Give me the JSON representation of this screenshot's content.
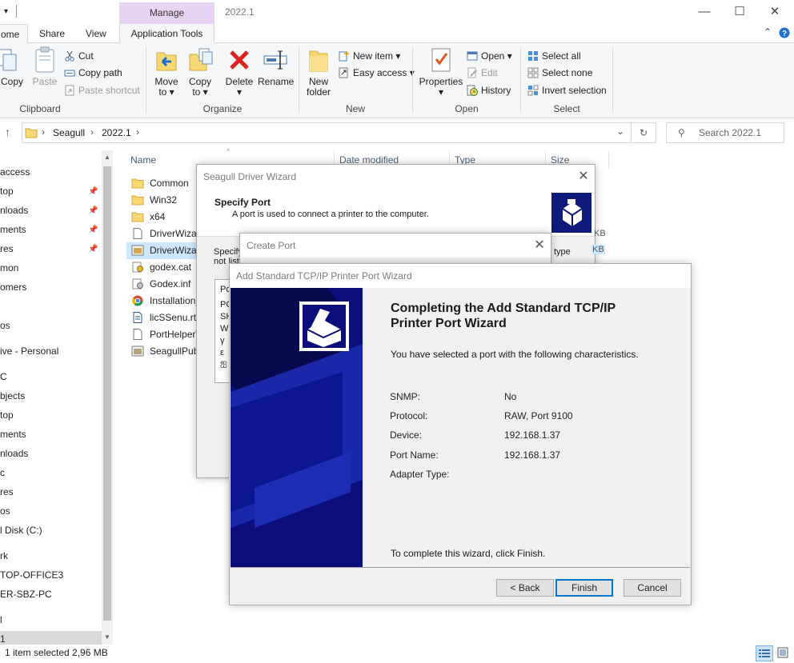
{
  "window": {
    "title": "2022.1",
    "manage_tab": "Manage",
    "minimize": "—",
    "maximize": "☐",
    "close": "✕"
  },
  "tabs": [
    "ome",
    "Share",
    "View",
    "Application Tools"
  ],
  "ribbon": {
    "clipboard": {
      "label": "Clipboard",
      "copy": "Copy",
      "paste": "Paste",
      "cut": "Cut",
      "copy_path": "Copy path",
      "paste_shortcut": "Paste shortcut"
    },
    "organize": {
      "label": "Organize",
      "move_to": "Move",
      "move_to_2": "to",
      "copy_to": "Copy",
      "copy_to_2": "to",
      "delete": "Delete",
      "rename": "Rename"
    },
    "new": {
      "label": "New",
      "new_folder": "New",
      "new_folder_2": "folder",
      "new_item": "New item",
      "easy_access": "Easy access"
    },
    "open": {
      "label": "Open",
      "properties": "Properties",
      "open": "Open",
      "edit": "Edit",
      "history": "History"
    },
    "select": {
      "label": "Select",
      "select_all": "Select all",
      "select_none": "Select none",
      "invert": "Invert selection"
    }
  },
  "address": {
    "crumbs": [
      "Seagull",
      "2022.1"
    ],
    "search_placeholder": "Search 2022.1"
  },
  "nav": {
    "items": [
      "access",
      "top",
      "nloads",
      "ments",
      "res",
      "mon",
      "omers",
      "",
      "os",
      "ive - Personal",
      "C",
      "bjects",
      "top",
      "ments",
      "nloads",
      "c",
      "res",
      "os",
      "l Disk (C:)",
      "",
      "rk",
      "TOP-OFFICE3",
      "ER-SBZ-PC",
      "",
      "l",
      "1"
    ]
  },
  "columns": {
    "name": "Name",
    "date": "Date modified",
    "type": "Type",
    "size": "Size"
  },
  "files": [
    {
      "name": "Common",
      "kind": "folder"
    },
    {
      "name": "Win32",
      "kind": "folder"
    },
    {
      "name": "x64",
      "kind": "folder"
    },
    {
      "name": "DriverWizard.exe.config",
      "kind": "doc"
    },
    {
      "name": "DriverWizard.exe",
      "kind": "exe"
    },
    {
      "name": "godex.cat",
      "kind": "cat"
    },
    {
      "name": "Godex.inf",
      "kind": "inf"
    },
    {
      "name": "Installation_Instructions",
      "kind": "chrome"
    },
    {
      "name": "licSSenu.rtf",
      "kind": "rtf"
    },
    {
      "name": "PortHelperWizard",
      "kind": "doc"
    },
    {
      "name": "SeagullPublisher",
      "kind": "exe"
    }
  ],
  "status": {
    "selection": "1 item selected  2,96 MB"
  },
  "driver_wizard": {
    "title": "Seagull Driver Wizard",
    "heading": "Specify Port",
    "subheading": "A port is used to connect a printer to the computer.",
    "body_frag_1": "Specify",
    "body_frag_2": "not list",
    "list_frags": [
      "Po",
      "PC",
      "SH",
      "WS",
      "γ",
      "ε",
      "ஐ"
    ],
    "right_frag_1": "type",
    "kb_1": "KB",
    "kb_2": "KB"
  },
  "create_port": {
    "title": "Create Port"
  },
  "tcp_wizard": {
    "title": "Add Standard TCP/IP Printer Port Wizard",
    "heading_1": "Completing the Add Standard TCP/IP",
    "heading_2": "Printer Port Wizard",
    "intro": "You have selected a port with the following characteristics.",
    "props": [
      {
        "label": "SNMP:",
        "value": "No"
      },
      {
        "label": "Protocol:",
        "value": "RAW, Port 9100"
      },
      {
        "label": "Device:",
        "value": "192.168.1.37"
      },
      {
        "label": "Port Name:",
        "value": "192.168.1.37"
      },
      {
        "label": "Adapter Type:",
        "value": ""
      }
    ],
    "finish_note": "To complete this wizard, click Finish.",
    "back": "< Back",
    "finish": "Finish",
    "cancel": "Cancel"
  }
}
